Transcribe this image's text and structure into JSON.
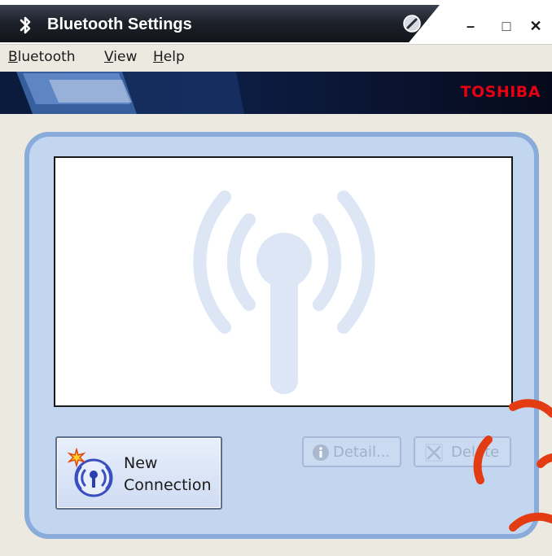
{
  "window": {
    "title": "Bluetooth Settings",
    "minimize_glyph": "–",
    "maximize_glyph": "□",
    "close_glyph": "✕"
  },
  "menu": {
    "items": [
      {
        "accel": "B",
        "rest": "luetooth"
      },
      {
        "accel": "V",
        "rest": "iew"
      },
      {
        "accel": "H",
        "rest": "elp"
      }
    ]
  },
  "banner": {
    "brand": "TOSHIBA",
    "brand_color": "#e60012"
  },
  "device_list": {
    "items": []
  },
  "buttons": {
    "new_connection": {
      "line1": "New",
      "line2": "Connection",
      "icon": "new-connection-icon"
    },
    "detail": {
      "label": "Detail...",
      "enabled": false,
      "icon": "info-icon"
    },
    "delete": {
      "label": "Delete",
      "enabled": false,
      "icon": "delete-icon"
    }
  },
  "colors": {
    "panel": "#c2d6f0",
    "panel_border": "#89acdb",
    "watermark": "#dce6f5"
  }
}
